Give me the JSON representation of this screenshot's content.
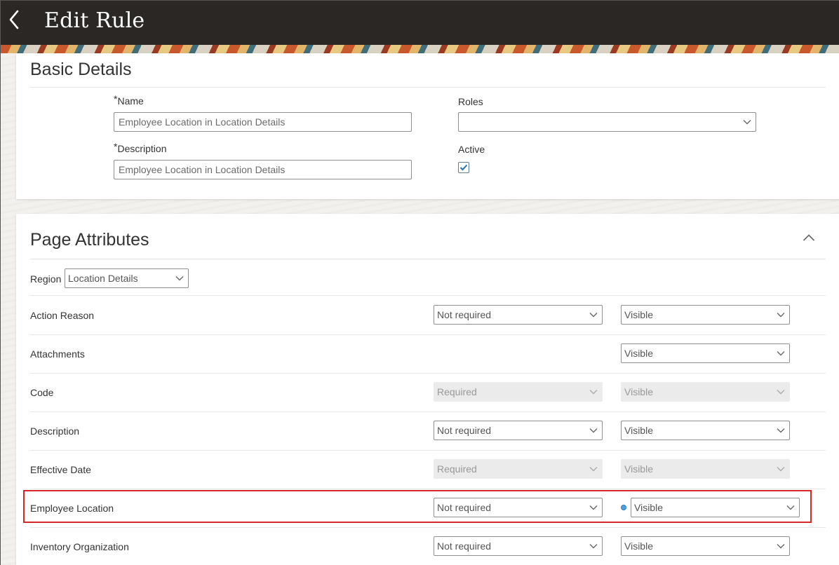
{
  "header": {
    "title": "Edit Rule"
  },
  "basic_details": {
    "section_title": "Basic Details",
    "name": {
      "required_mark": "*",
      "label": "Name",
      "value": "Employee Location in Location Details"
    },
    "description": {
      "required_mark": "*",
      "label": "Description",
      "value": "Employee Location in Location Details"
    },
    "roles": {
      "label": "Roles",
      "value": ""
    },
    "active": {
      "label": "Active",
      "checked": true
    }
  },
  "page_attributes": {
    "section_title": "Page Attributes",
    "region": {
      "label": "Region",
      "value": "Location Details"
    },
    "rows": [
      {
        "label": "Action Reason",
        "required": "Not required",
        "required_enabled": true,
        "visibility": "Visible",
        "visibility_enabled": true,
        "modified": false
      },
      {
        "label": "Attachments",
        "required": null,
        "required_enabled": false,
        "visibility": "Visible",
        "visibility_enabled": true,
        "modified": false
      },
      {
        "label": "Code",
        "required": "Required",
        "required_enabled": false,
        "visibility": "Visible",
        "visibility_enabled": false,
        "modified": false
      },
      {
        "label": "Description",
        "required": "Not required",
        "required_enabled": true,
        "visibility": "Visible",
        "visibility_enabled": true,
        "modified": false
      },
      {
        "label": "Effective Date",
        "required": "Required",
        "required_enabled": false,
        "visibility": "Visible",
        "visibility_enabled": false,
        "modified": false
      },
      {
        "label": "Employee Location",
        "required": "Not required",
        "required_enabled": true,
        "visibility": "Visible",
        "visibility_enabled": true,
        "modified": true,
        "highlighted": true
      },
      {
        "label": "Inventory Organization",
        "required": "Not required",
        "required_enabled": true,
        "visibility": "Visible",
        "visibility_enabled": true,
        "modified": false
      }
    ]
  },
  "colors": {
    "header_bg": "#2b2724",
    "highlight_border": "#d6262a",
    "modified_dot": "#4d9fe0",
    "checkbox_tick": "#2a6fa8"
  },
  "icons": {
    "back": "chevron-left-icon",
    "collapse": "chevron-up-icon",
    "dropdown": "chevron-down-icon",
    "check": "checkmark-icon"
  }
}
